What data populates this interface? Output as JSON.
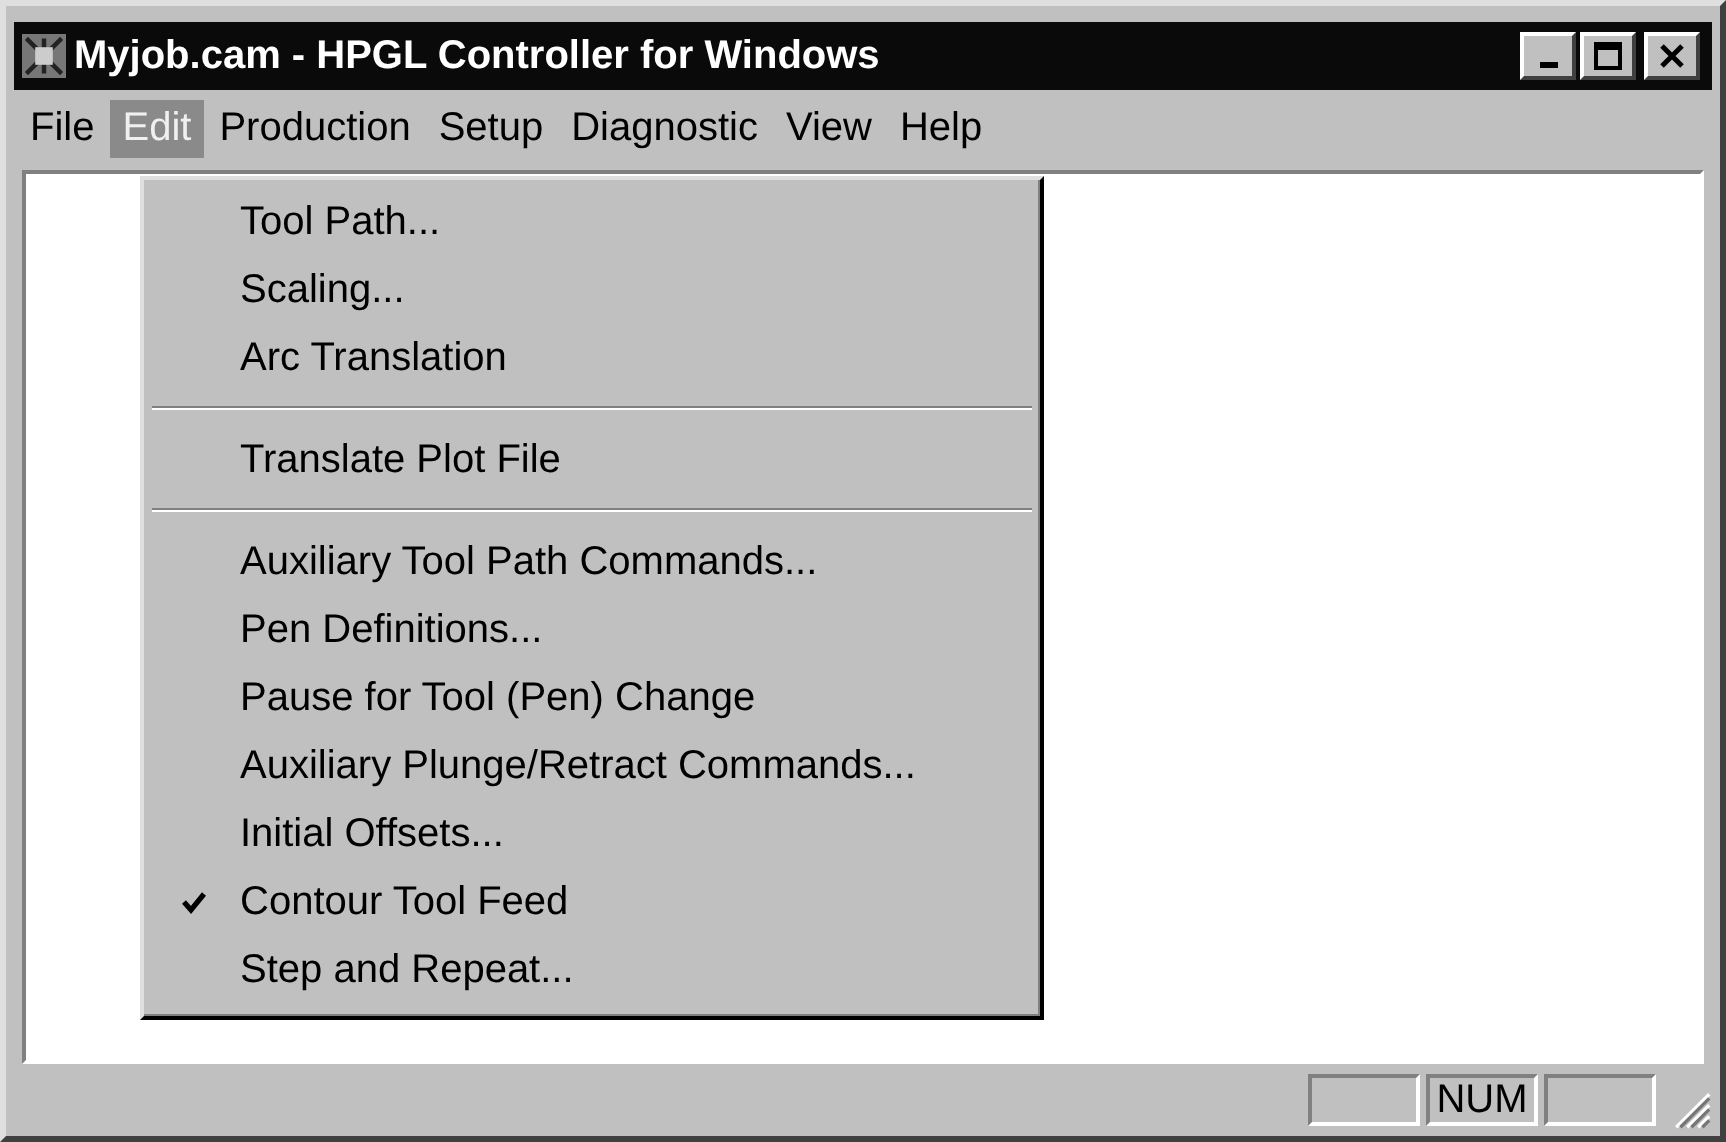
{
  "window": {
    "title": "Myjob.cam - HPGL Controller for Windows"
  },
  "menu_bar": [
    {
      "label": "File",
      "selected": false
    },
    {
      "label": "Edit",
      "selected": true
    },
    {
      "label": "Production",
      "selected": false
    },
    {
      "label": "Setup",
      "selected": false
    },
    {
      "label": "Diagnostic",
      "selected": false
    },
    {
      "label": "View",
      "selected": false
    },
    {
      "label": "Help",
      "selected": false
    }
  ],
  "edit_menu": [
    {
      "kind": "item",
      "label": "Tool Path...",
      "checked": false
    },
    {
      "kind": "item",
      "label": "Scaling...",
      "checked": false
    },
    {
      "kind": "item",
      "label": "Arc Translation",
      "checked": false
    },
    {
      "kind": "separator"
    },
    {
      "kind": "item",
      "label": "Translate Plot File",
      "checked": false
    },
    {
      "kind": "separator"
    },
    {
      "kind": "item",
      "label": "Auxiliary Tool Path Commands...",
      "checked": false
    },
    {
      "kind": "item",
      "label": "Pen Definitions...",
      "checked": false
    },
    {
      "kind": "item",
      "label": "Pause for Tool (Pen) Change",
      "checked": false
    },
    {
      "kind": "item",
      "label": "Auxiliary Plunge/Retract Commands...",
      "checked": false
    },
    {
      "kind": "item",
      "label": "Initial Offsets...",
      "checked": false
    },
    {
      "kind": "item",
      "label": "Contour Tool Feed",
      "checked": true
    },
    {
      "kind": "item",
      "label": "Step and Repeat...",
      "checked": false
    }
  ],
  "status_bar": {
    "panels": [
      {
        "kind": "empty"
      },
      {
        "kind": "text",
        "text": "NUM"
      },
      {
        "kind": "empty"
      }
    ]
  }
}
